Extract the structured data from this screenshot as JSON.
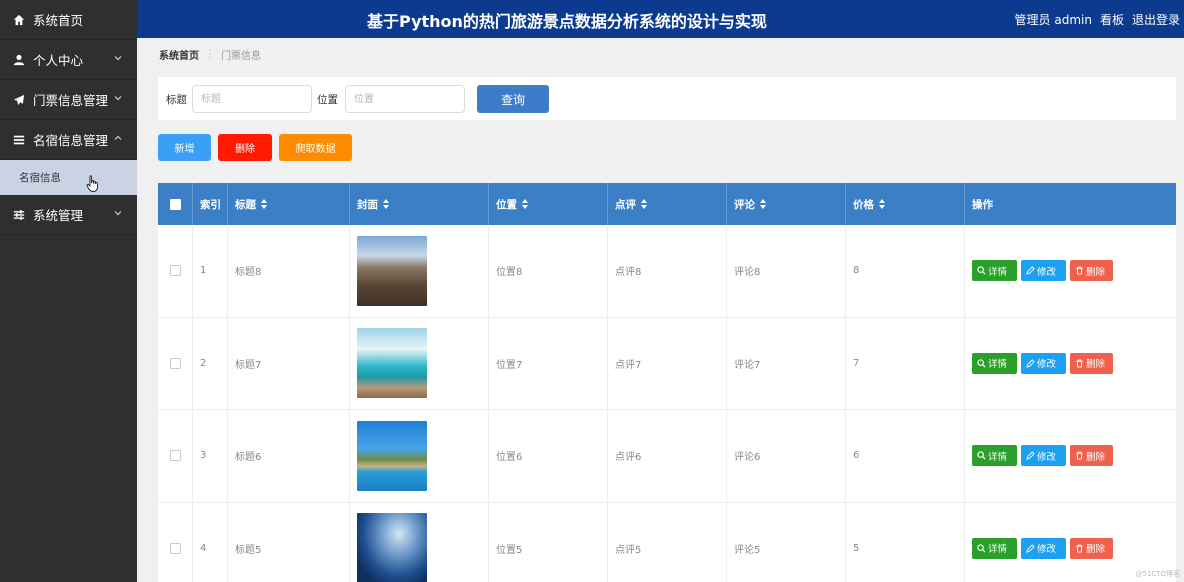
{
  "sidebar": {
    "items": [
      {
        "label": "系统首页",
        "icon": "home-icon"
      },
      {
        "label": "个人中心",
        "icon": "user-icon"
      },
      {
        "label": "门票信息管理",
        "icon": "paper-plane-icon"
      },
      {
        "label": "名宿信息管理",
        "icon": "list-icon"
      },
      {
        "label": "系统管理",
        "icon": "sliders-icon"
      }
    ],
    "sub_item": "名宿信息"
  },
  "header": {
    "title": "基于Python的热门旅游景点数据分析系统的设计与实现",
    "user": "管理员 admin",
    "board": "看板",
    "logout": "退出登录"
  },
  "breadcrumb": {
    "home": "系统首页",
    "current": "门票信息"
  },
  "search": {
    "title_label": "标题",
    "title_placeholder": "标题",
    "location_label": "位置",
    "location_placeholder": "位置",
    "query_button": "查询"
  },
  "actions": {
    "add": "新增",
    "delete": "删除",
    "crawl": "爬取数据"
  },
  "table": {
    "headers": [
      "索引",
      "标题",
      "封面",
      "位置",
      "点评",
      "评论",
      "价格",
      "操作"
    ],
    "rows": [
      {
        "index": "1",
        "title": "标题8",
        "location": "位置8",
        "review": "点评8",
        "comment": "评论8",
        "price": "8"
      },
      {
        "index": "2",
        "title": "标题7",
        "location": "位置7",
        "review": "点评7",
        "comment": "评论7",
        "price": "7"
      },
      {
        "index": "3",
        "title": "标题6",
        "location": "位置6",
        "review": "点评6",
        "comment": "评论6",
        "price": "6"
      },
      {
        "index": "4",
        "title": "标题5",
        "location": "位置5",
        "review": "点评5",
        "comment": "评论5",
        "price": "5"
      }
    ],
    "op_labels": {
      "detail": "详情",
      "edit": "修改",
      "delete": "删除"
    }
  },
  "colors": {
    "header_bg": "#0b3a8e",
    "sidebar_bg": "#2f2f2f",
    "table_header_bg": "#3b80c6",
    "add_button": "#3a9ff5",
    "delete_button": "#ff1a00",
    "crawl_button": "#ff8c00"
  },
  "watermark": "@51CTO博客"
}
